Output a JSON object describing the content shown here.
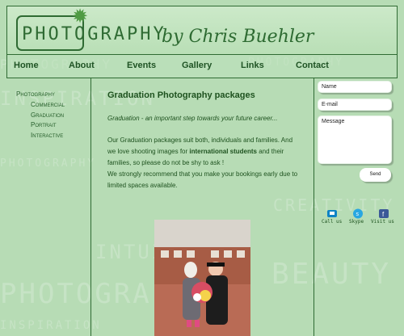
{
  "branding": {
    "logo_text": "PHOTOGRAPHY",
    "logo_script": "by Chris Buehler"
  },
  "nav": {
    "items": [
      "Home",
      "About",
      "Events",
      "Gallery",
      "Links",
      "Contact"
    ]
  },
  "sidebar": {
    "items": [
      "Photography",
      "Commercial",
      "Graduation",
      "Portrait",
      "Interactive"
    ]
  },
  "page": {
    "title": "Graduation Photography packages",
    "tagline": "Graduation - an important step towards your future career...",
    "paragraphs": [
      "Our Graduation packages suit both, individuals and families. And we love shooting images for",
      "international students",
      "and their families, so please do not be shy to ask !",
      "We strongly recommend that you make your bookings early due to limited spaces available."
    ]
  },
  "contact_form": {
    "name_placeholder": "Name",
    "email_placeholder": "E-mail",
    "message_placeholder": "Message",
    "send_label": "Send"
  },
  "contact_links": [
    {
      "label": "Call us",
      "icon": "phone-icon"
    },
    {
      "label": "Skype",
      "icon": "skype-icon"
    },
    {
      "label": "Visit us",
      "icon": "facebook-icon"
    }
  ],
  "background_words": [
    "PHOTOGRAPHY",
    "INSPIRATION",
    "CREATIVITY",
    "INTUITION",
    "BEAUTY"
  ],
  "colors": {
    "background": "#b7dcb5",
    "accent": "#2f6b33",
    "text": "#1e521f"
  }
}
